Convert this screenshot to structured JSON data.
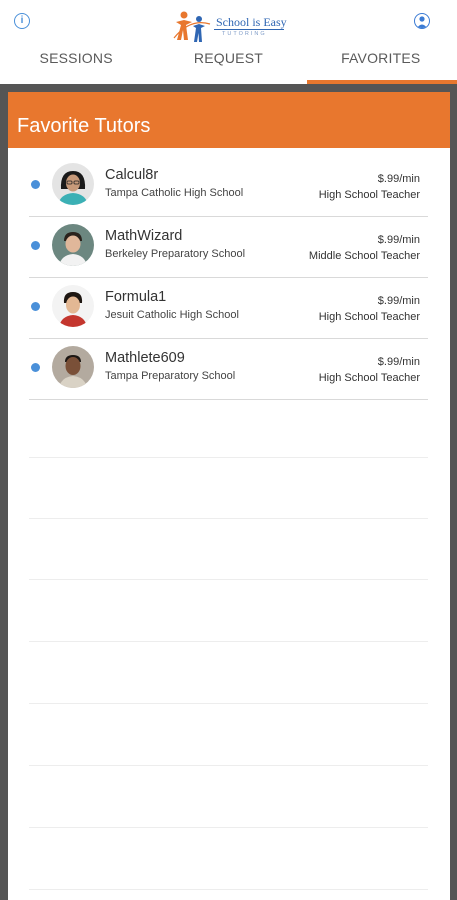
{
  "header": {
    "logo_text": "School is Easy",
    "logo_sub": "TUTORING",
    "info_icon": "info-icon",
    "profile_icon": "profile-icon"
  },
  "tabs": [
    {
      "label": "SESSIONS",
      "active": false
    },
    {
      "label": "REQUEST",
      "active": false
    },
    {
      "label": "FAVORITES",
      "active": true
    }
  ],
  "favorites": {
    "title": "Favorite Tutors",
    "tutors": [
      {
        "name": "Calcul8r",
        "school": "Tampa Catholic High School",
        "rate": "$.99/min",
        "role": "High School Teacher"
      },
      {
        "name": "MathWizard",
        "school": "Berkeley Preparatory School",
        "rate": "$.99/min",
        "role": "Middle School Teacher"
      },
      {
        "name": "Formula1",
        "school": "Jesuit Catholic High School",
        "rate": "$.99/min",
        "role": "High School Teacher"
      },
      {
        "name": "Mathlete609",
        "school": "Tampa Preparatory School",
        "rate": "$.99/min",
        "role": "High School Teacher"
      }
    ]
  },
  "colors": {
    "accent": "#e8772e",
    "status_dot": "#4a90d9",
    "background": "#555555"
  }
}
